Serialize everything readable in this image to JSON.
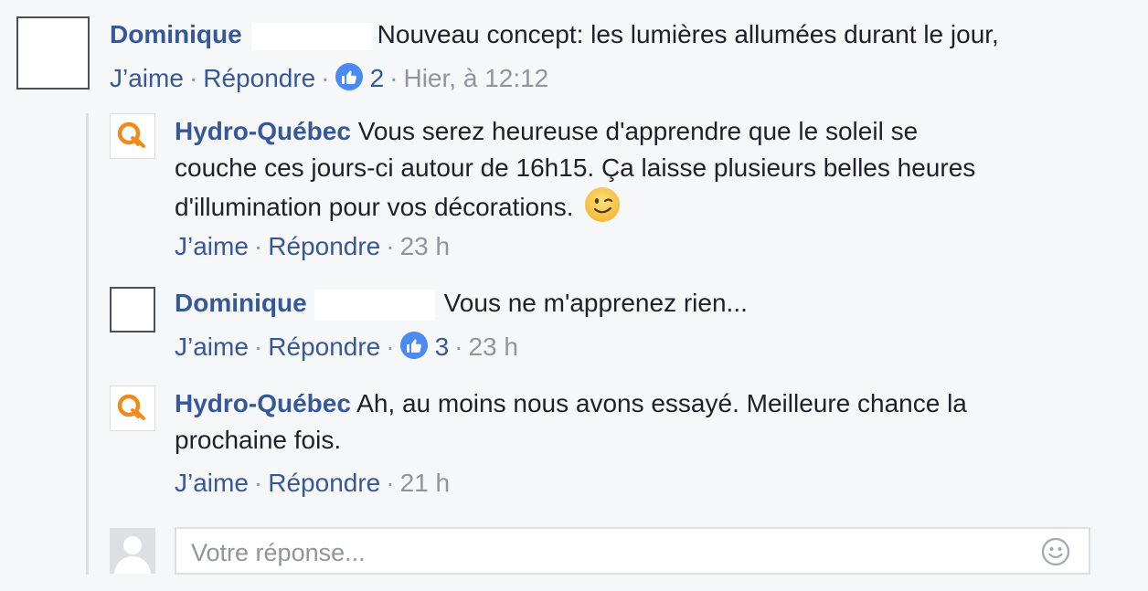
{
  "comments": [
    {
      "author": "Dominique",
      "text": "Nouveau concept: les lumières allumées durant le jour,",
      "like_label": "J’aime",
      "reply_label": "Répondre",
      "reaction_count": "2",
      "timestamp": "Hier, à 12:12"
    }
  ],
  "replies": [
    {
      "author": "Hydro-Québec",
      "text_lines": [
        "Vous serez heureuse d'apprendre que le soleil se",
        "couche ces jours-ci autour de 16h15. Ça laisse plusieurs belles heures",
        "d'illumination pour vos décorations."
      ],
      "emoji": "winking-face-emoji",
      "like_label": "J’aime",
      "reply_label": "Répondre",
      "timestamp": "23 h"
    },
    {
      "author": "Dominique",
      "text": "Vous ne m'apprenez rien...",
      "like_label": "J’aime",
      "reply_label": "Répondre",
      "reaction_count": "3",
      "timestamp": "23 h"
    },
    {
      "author": "Hydro-Québec",
      "text_lines": [
        "Ah, au moins nous avons essayé. Meilleure chance la",
        "prochaine fois."
      ],
      "like_label": "J’aime",
      "reply_label": "Répondre",
      "timestamp": "21 h"
    }
  ],
  "reply_box": {
    "placeholder": "Votre réponse...",
    "emoji_icon": "smiley-icon"
  },
  "colors": {
    "link": "#365899",
    "meta": "#90949c",
    "text": "#1d2129",
    "background": "#f6f7f9",
    "like_badge": "#4a8af4",
    "hq_orange": "#f08a1c"
  }
}
